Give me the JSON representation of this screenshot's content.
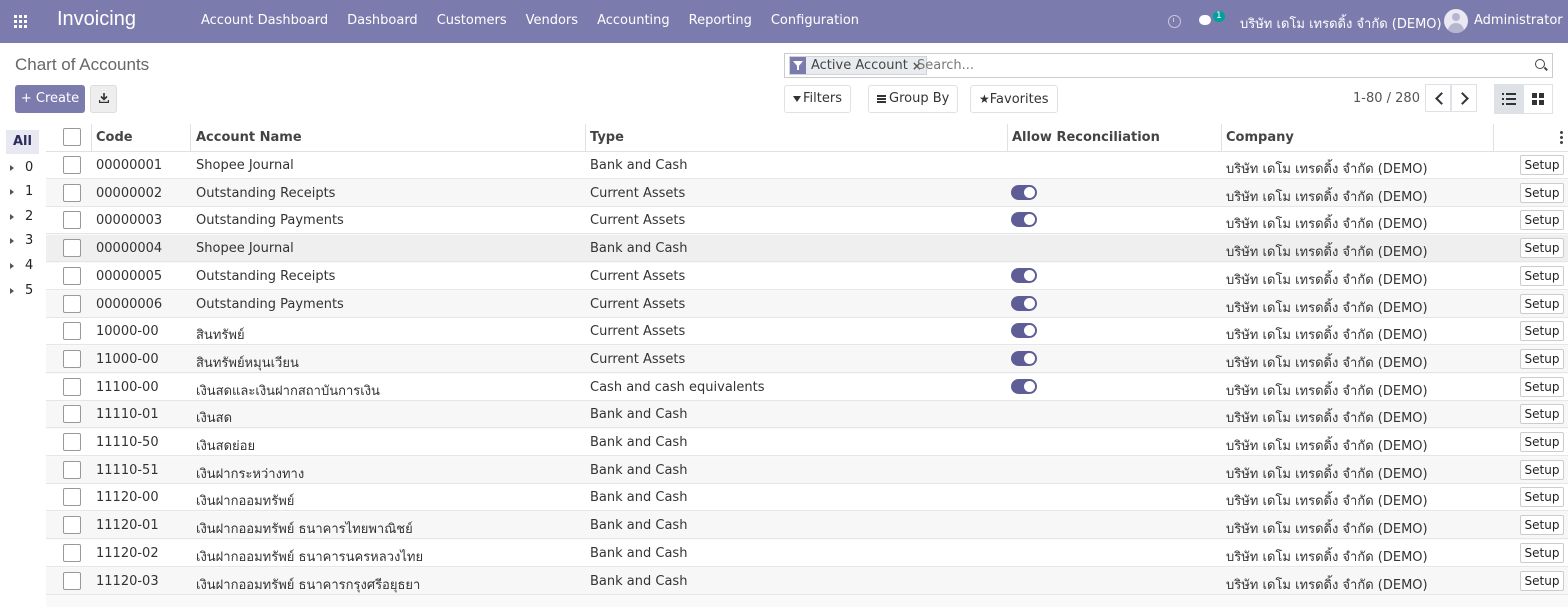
{
  "navbar": {
    "app_title": "Invoicing",
    "menu": [
      "Account Dashboard",
      "Dashboard",
      "Customers",
      "Vendors",
      "Accounting",
      "Reporting",
      "Configuration"
    ],
    "chat_count": "1",
    "company": "บริษัท เดโม เทรดดิ้ง จำกัด (DEMO)",
    "user": "Administrator"
  },
  "control_panel": {
    "breadcrumb": "Chart of Accounts",
    "create_label": "+ Create",
    "facet_label": "Active Account",
    "facet_remove": "×",
    "search_placeholder": "Search...",
    "filters_label": "Filters",
    "groupby_label": "Group By",
    "favorites_label": "Favorites",
    "pager": "1-80 / 280"
  },
  "sidebar": {
    "all_label": "All",
    "items": [
      "0",
      "1",
      "2",
      "3",
      "4",
      "5"
    ]
  },
  "table": {
    "columns": [
      "Code",
      "Account Name",
      "Type",
      "Allow Reconciliation",
      "Company"
    ],
    "setup_label": "Setup",
    "rows": [
      {
        "code": "00000001",
        "name": "Shopee Journal",
        "type": "Bank and Cash",
        "reconcile": false,
        "company": "บริษัท เดโม เทรดดิ้ง จำกัด (DEMO)"
      },
      {
        "code": "00000002",
        "name": "Outstanding Receipts",
        "type": "Current Assets",
        "reconcile": true,
        "company": "บริษัท เดโม เทรดดิ้ง จำกัด (DEMO)"
      },
      {
        "code": "00000003",
        "name": "Outstanding Payments",
        "type": "Current Assets",
        "reconcile": true,
        "company": "บริษัท เดโม เทรดดิ้ง จำกัด (DEMO)"
      },
      {
        "code": "00000004",
        "name": "Shopee Journal",
        "type": "Bank and Cash",
        "reconcile": false,
        "company": "บริษัท เดโม เทรดดิ้ง จำกัด (DEMO)"
      },
      {
        "code": "00000005",
        "name": "Outstanding Receipts",
        "type": "Current Assets",
        "reconcile": true,
        "company": "บริษัท เดโม เทรดดิ้ง จำกัด (DEMO)"
      },
      {
        "code": "00000006",
        "name": "Outstanding Payments",
        "type": "Current Assets",
        "reconcile": true,
        "company": "บริษัท เดโม เทรดดิ้ง จำกัด (DEMO)"
      },
      {
        "code": "10000-00",
        "name": "สินทรัพย์",
        "type": "Current Assets",
        "reconcile": true,
        "company": "บริษัท เดโม เทรดดิ้ง จำกัด (DEMO)"
      },
      {
        "code": "11000-00",
        "name": "สินทรัพย์หมุนเวียน",
        "type": "Current Assets",
        "reconcile": true,
        "company": "บริษัท เดโม เทรดดิ้ง จำกัด (DEMO)"
      },
      {
        "code": "11100-00",
        "name": "เงินสดและเงินฝากสถาบันการเงิน",
        "type": "Cash and cash equivalents",
        "reconcile": true,
        "company": "บริษัท เดโม เทรดดิ้ง จำกัด (DEMO)"
      },
      {
        "code": "11110-01",
        "name": "เงินสด",
        "type": "Bank and Cash",
        "reconcile": false,
        "company": "บริษัท เดโม เทรดดิ้ง จำกัด (DEMO)"
      },
      {
        "code": "11110-50",
        "name": "เงินสดย่อย",
        "type": "Bank and Cash",
        "reconcile": false,
        "company": "บริษัท เดโม เทรดดิ้ง จำกัด (DEMO)"
      },
      {
        "code": "11110-51",
        "name": "เงินฝากระหว่างทาง",
        "type": "Bank and Cash",
        "reconcile": false,
        "company": "บริษัท เดโม เทรดดิ้ง จำกัด (DEMO)"
      },
      {
        "code": "11120-00",
        "name": "เงินฝากออมทรัพย์",
        "type": "Bank and Cash",
        "reconcile": false,
        "company": "บริษัท เดโม เทรดดิ้ง จำกัด (DEMO)"
      },
      {
        "code": "11120-01",
        "name": "เงินฝากออมทรัพย์ ธนาคารไทยพาณิชย์",
        "type": "Bank and Cash",
        "reconcile": false,
        "company": "บริษัท เดโม เทรดดิ้ง จำกัด (DEMO)"
      },
      {
        "code": "11120-02",
        "name": "เงินฝากออมทรัพย์ ธนาคารนครหลวงไทย",
        "type": "Bank and Cash",
        "reconcile": false,
        "company": "บริษัท เดโม เทรดดิ้ง จำกัด (DEMO)"
      },
      {
        "code": "11120-03",
        "name": "เงินฝากออมทรัพย์ ธนาคารกรุงศรีอยุธยา",
        "type": "Bank and Cash",
        "reconcile": false,
        "company": "บริษัท เดโม เทรดดิ้ง จำกัด (DEMO)"
      }
    ]
  },
  "colors": {
    "brand": "#7c7bad",
    "toggle_on": "#5e5d96"
  }
}
